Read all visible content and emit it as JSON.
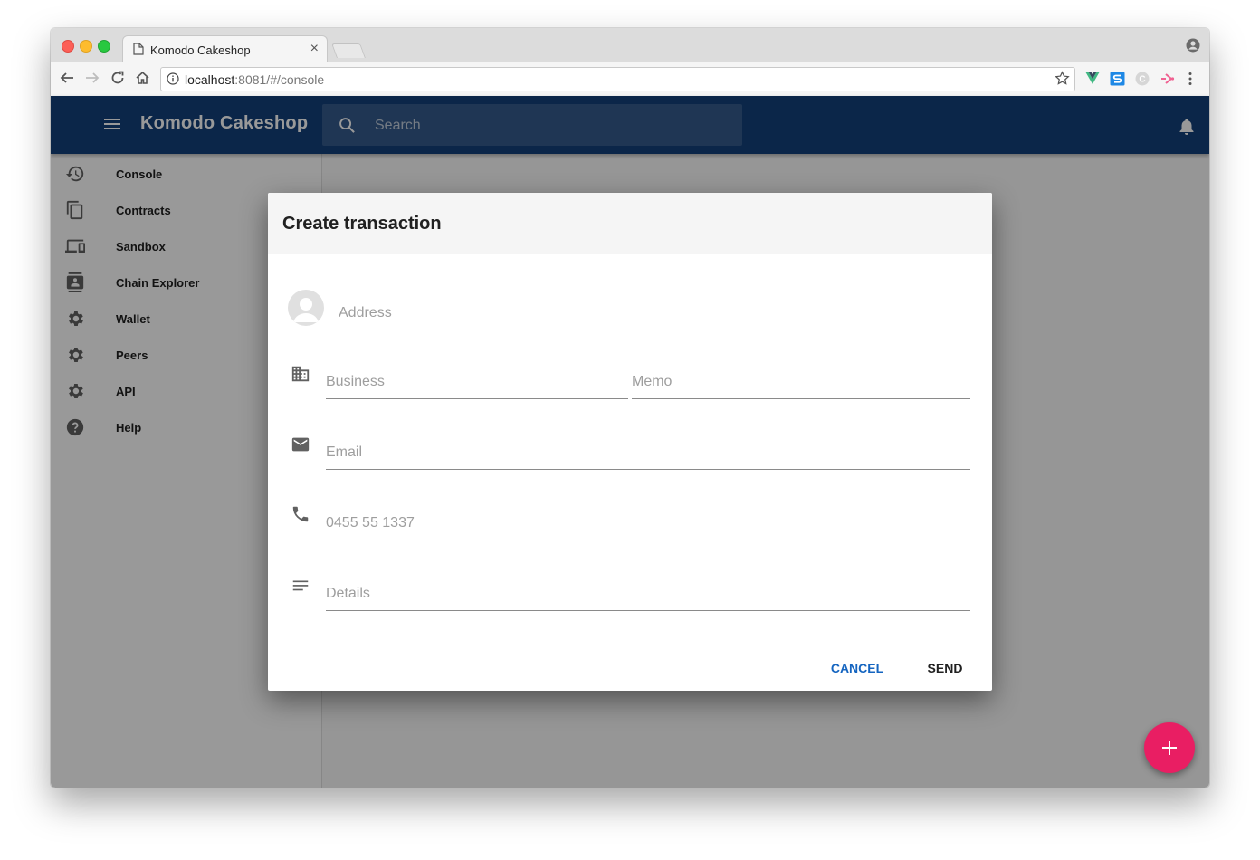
{
  "browser": {
    "tab_title": "Komodo Cakeshop",
    "url_host": "localhost",
    "url_rest": ":8081/#/console"
  },
  "app": {
    "title": "Komodo Cakeshop",
    "search_placeholder": "Search"
  },
  "sidebar": {
    "items": [
      {
        "label": "Console",
        "icon": "history-icon"
      },
      {
        "label": "Contracts",
        "icon": "copy-icon"
      },
      {
        "label": "Sandbox",
        "icon": "devices-icon"
      },
      {
        "label": "Chain Explorer",
        "icon": "contacts-icon"
      },
      {
        "label": "Wallet",
        "icon": "gear-icon"
      },
      {
        "label": "Peers",
        "icon": "gear-icon"
      },
      {
        "label": "API",
        "icon": "gear-icon"
      },
      {
        "label": "Help",
        "icon": "help-icon"
      }
    ]
  },
  "dialog": {
    "title": "Create transaction",
    "address_placeholder": "Address",
    "business_placeholder": "Business",
    "memo_placeholder": "Memo",
    "email_placeholder": "Email",
    "phone_placeholder": "0455 55 1337",
    "details_placeholder": "Details",
    "cancel_label": "CANCEL",
    "send_label": "SEND"
  },
  "colors": {
    "appbar": "#13407a",
    "accent": "#1565c0",
    "fab": "#e91e63"
  }
}
